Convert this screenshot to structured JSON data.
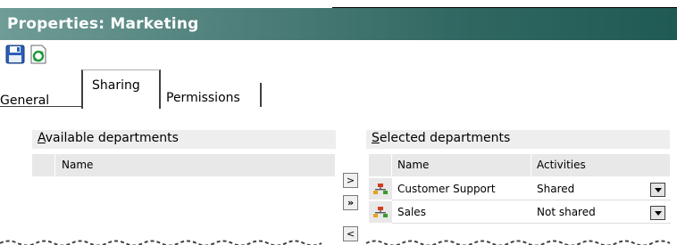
{
  "window": {
    "title": "Properties: Marketing"
  },
  "toolbar": {
    "save_icon": "save-icon",
    "refresh_icon": "refresh-icon"
  },
  "tabs": [
    {
      "label": "General"
    },
    {
      "label": "Sharing",
      "active": true
    },
    {
      "label": "Permissions"
    }
  ],
  "available": {
    "title_accesskey": "A",
    "title_rest": "vailable departments",
    "columns": [
      "Name"
    ],
    "rows": []
  },
  "selected": {
    "title_accesskey": "S",
    "title_rest": "elected departments",
    "columns": [
      "Name",
      "Activities"
    ],
    "rows": [
      {
        "name": "Customer Support",
        "activity": "Shared",
        "icon": "department-icon"
      },
      {
        "name": "Sales",
        "activity": "Not shared",
        "icon": "department-icon"
      }
    ]
  },
  "transfer_buttons": {
    "add": ">",
    "add_all": "»",
    "remove": "<"
  },
  "colors": {
    "title_bar_start": "#6f9c96",
    "title_bar_end": "#205a55",
    "header_bg": "#e8e8e8",
    "panel_title_bg": "#eeeeee"
  }
}
